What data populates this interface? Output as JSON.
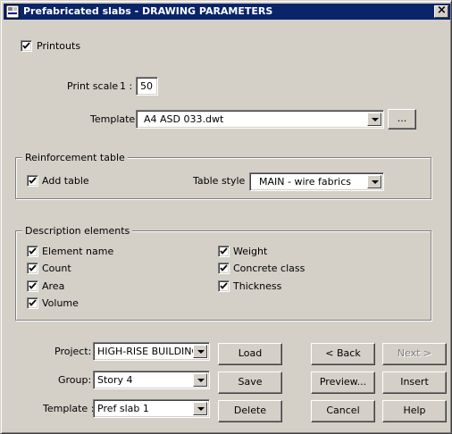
{
  "window": {
    "title": "Prefabricated slabs - DRAWING PARAMETERS",
    "close_glyph": "×"
  },
  "printouts": {
    "label": "Printouts",
    "checked": true
  },
  "print_scale": {
    "label": "Print scale",
    "prefix": "1 :",
    "value": "50"
  },
  "template_file": {
    "label": "Template",
    "value": "A4 ASD 033.dwt",
    "browse_label": "..."
  },
  "reinforcement": {
    "group_label": "Reinforcement table",
    "add_table_label": "Add table",
    "table_style_label": "Table style",
    "table_style_value": "MAIN - wire fabrics"
  },
  "description": {
    "group_label": "Description elements",
    "items": [
      {
        "label": "Element name",
        "checked": true
      },
      {
        "label": "Count",
        "checked": true
      },
      {
        "label": "Area",
        "checked": true
      },
      {
        "label": "Volume",
        "checked": true
      },
      {
        "label": "Weight",
        "checked": true
      },
      {
        "label": "Concrete class",
        "checked": true
      },
      {
        "label": "Thickness",
        "checked": true
      }
    ]
  },
  "bottom": {
    "project_label": "Project:",
    "project_value": "HIGH-RISE BUILDING",
    "group_label": "Group:",
    "group_value": "Story 4",
    "template_label": "Template :",
    "template_value": "Pref slab 1"
  },
  "buttons": {
    "load": "Load",
    "save": "Save",
    "delete": "Delete",
    "back": "< Back",
    "next": "Next >",
    "preview": "Preview...",
    "insert": "Insert",
    "cancel": "Cancel",
    "help": "Help"
  },
  "colors": {
    "titlebar": "#0a246a",
    "face": "#d4d0c8"
  }
}
